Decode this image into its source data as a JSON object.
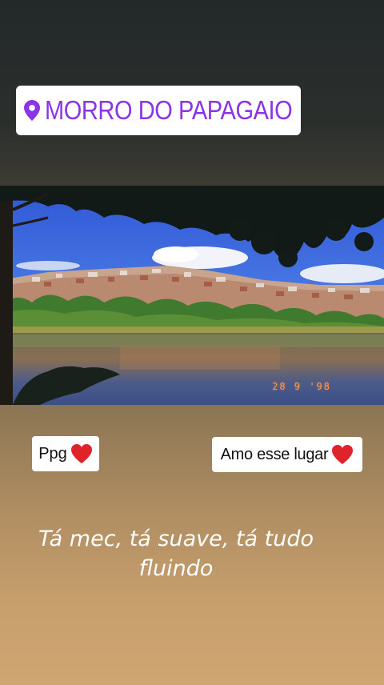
{
  "location_sticker": {
    "label": "MORRO DO PAPAGAIO",
    "icon": "location-pin-icon",
    "color": "#8a34e6"
  },
  "photo": {
    "date_stamp": "28 9 '98"
  },
  "stickers": {
    "ppg": {
      "label": "Ppg",
      "icon": "red-heart-icon"
    },
    "amo": {
      "label": "Amo esse lugar",
      "icon": "red-heart-icon"
    }
  },
  "caption": {
    "text": "Tá mec, tá suave, tá tudo fluindo"
  }
}
